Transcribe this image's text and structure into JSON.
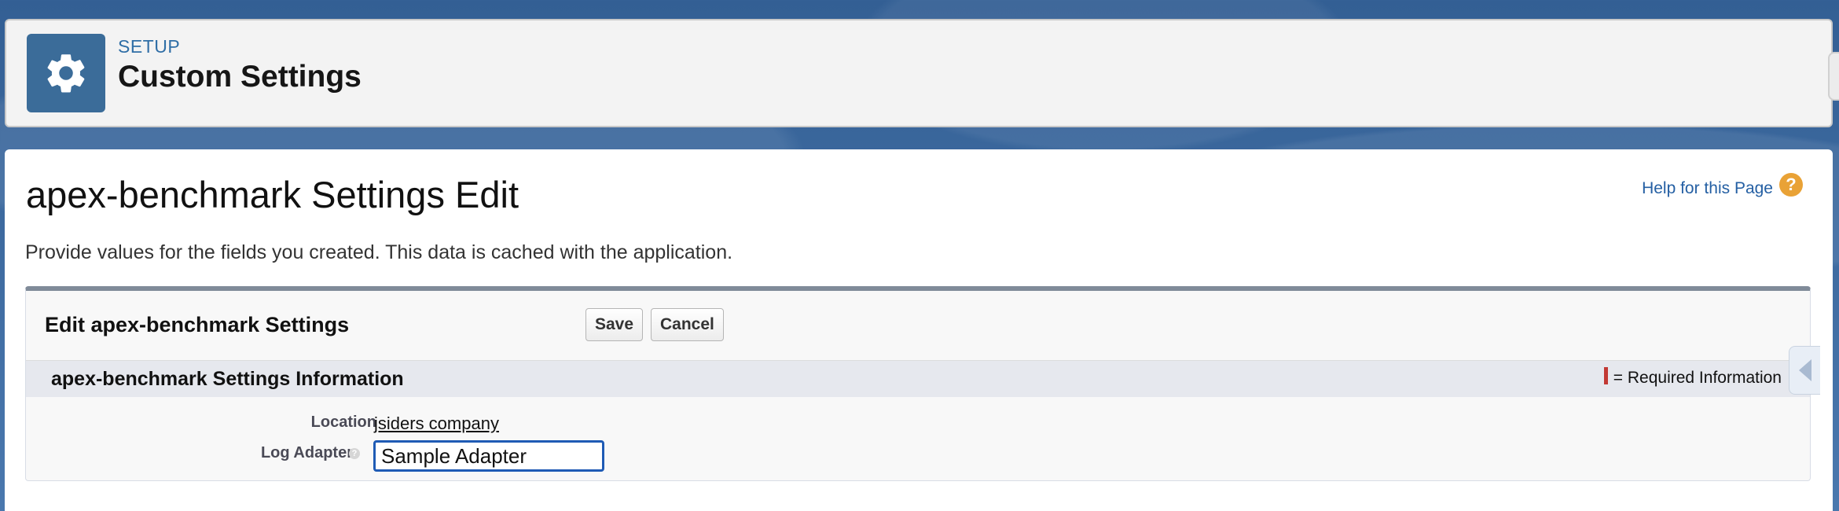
{
  "setup_header": {
    "label": "SETUP",
    "title": "Custom Settings",
    "icon": "gear-icon"
  },
  "page": {
    "title": "apex-benchmark Settings Edit",
    "help_link": "Help for this Page",
    "help_icon": "question-circle-icon",
    "description": "Provide values for the fields you created. This data is cached with the application."
  },
  "edit_block": {
    "title": "Edit apex-benchmark Settings",
    "save_label": "Save",
    "cancel_label": "Cancel"
  },
  "section": {
    "title": "apex-benchmark Settings Information",
    "required_legend": "= Required Information",
    "required_color": "#c23934"
  },
  "fields": {
    "location_label": "Location",
    "location_value": "jsiders company",
    "log_adapter_label": "Log Adapter",
    "log_adapter_value": "Sample Adapter",
    "info_icon": "info-icon"
  },
  "colors": {
    "accent_blue": "#1f5bb5",
    "header_icon_bg": "#3b6c99",
    "help_icon_bg": "#e9a236"
  }
}
